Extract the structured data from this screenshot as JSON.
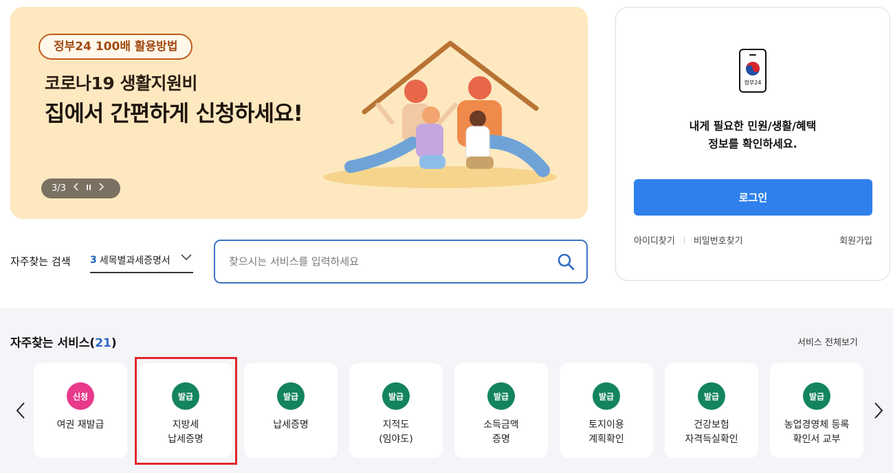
{
  "banner": {
    "tag": "정부24 100배 활용방법",
    "subtitle": "코로나19 생활지원비",
    "title": "집에서 간편하게 신청하세요!",
    "pager": "3/3",
    "prev_icon": "chevron-left-icon",
    "pause_icon": "pause-icon",
    "next_icon": "chevron-right-icon"
  },
  "search": {
    "favorites_label": "자주찾는 검색",
    "favorites_num": "3",
    "favorites_value": "세목별과세증명서",
    "placeholder": "찾으시는 서비스를 입력하세요"
  },
  "login": {
    "logo_text": "정부24",
    "message_line1": "내게 필요한 민원/생활/혜택",
    "message_line2": "정보를 확인하세요.",
    "login_button": "로그인",
    "find_id": "아이디찾기",
    "find_password": "비밀번호찾기",
    "signup": "회원가입"
  },
  "services": {
    "title": "자주찾는 서비스",
    "count_open": "(",
    "count": "21",
    "count_close": ")",
    "view_all": "서비스 전체보기",
    "cards": [
      {
        "badge": "신청",
        "label": "여권 재발급"
      },
      {
        "badge": "발급",
        "label": "지방세\n납세증명"
      },
      {
        "badge": "발급",
        "label": "납세증명"
      },
      {
        "badge": "발급",
        "label": "지적도\n(임야도)"
      },
      {
        "badge": "발급",
        "label": "소득금액\n증명"
      },
      {
        "badge": "발급",
        "label": "토지이용\n계획확인"
      },
      {
        "badge": "발급",
        "label": "건강보험\n자격득실확인"
      },
      {
        "badge": "발급",
        "label": "농업경영체 등록\n확인서 교부"
      }
    ]
  },
  "colors": {
    "banner_bg": "#fde8c0",
    "primary_blue": "#2f80ec",
    "badge_green": "#13845c",
    "badge_pink": "#e8398a",
    "highlight_red": "#e0272d"
  }
}
